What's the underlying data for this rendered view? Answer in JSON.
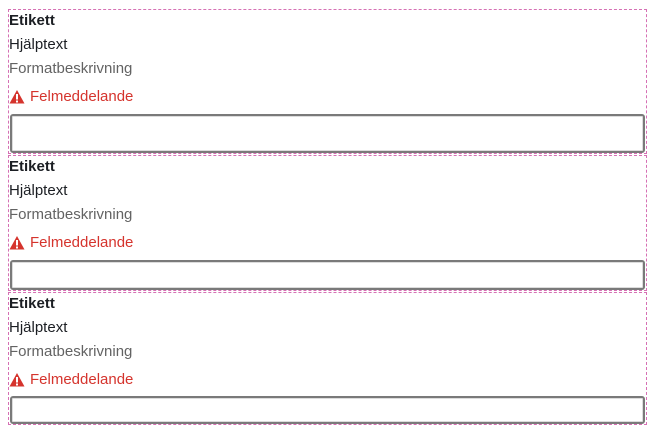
{
  "fields": [
    {
      "label": "Etikett",
      "help_text": "Hjälptext",
      "format_description": "Formatbeskrivning",
      "error_message": "Felmeddelande",
      "input_value": ""
    },
    {
      "label": "Etikett",
      "help_text": "Hjälptext",
      "format_description": "Formatbeskrivning",
      "error_message": "Felmeddelande",
      "input_value": ""
    },
    {
      "label": "Etikett",
      "help_text": "Hjälptext",
      "format_description": "Formatbeskrivning",
      "error_message": "Felmeddelande",
      "input_value": ""
    }
  ],
  "colors": {
    "error": "#d5342d",
    "format_text": "#636363",
    "debug_outline": "#d670b4",
    "input_border": "#7a7a7a"
  },
  "icons": {
    "error": "warning-triangle-icon"
  }
}
